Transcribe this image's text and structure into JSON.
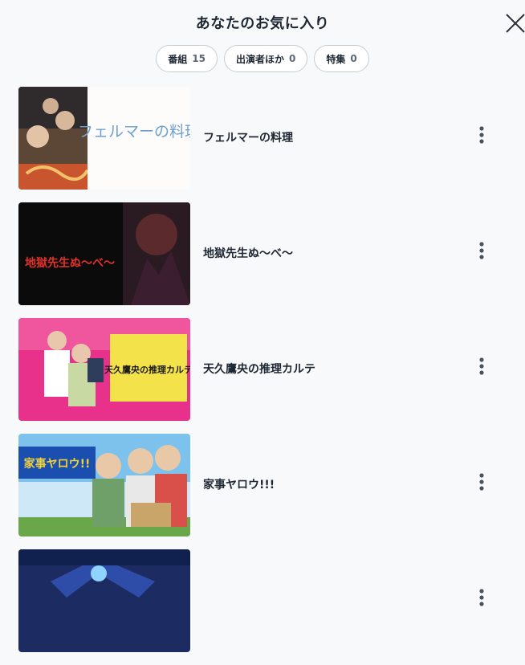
{
  "header": {
    "title": "あなたのお気に入り",
    "close_icon": "close-icon"
  },
  "tabs": [
    {
      "label": "番組",
      "count": "15"
    },
    {
      "label": "出演者ほか",
      "count": "0"
    },
    {
      "label": "特集",
      "count": "0"
    }
  ],
  "items": [
    {
      "title": "フェルマーの料理",
      "thumb_text": "フェルマーの料理"
    },
    {
      "title": "地獄先生ぬ～べ～",
      "thumb_text": "地獄先生ぬ～べ～"
    },
    {
      "title": "天久鷹央の推理カルテ",
      "thumb_text": "天久鷹央の推理カルテ"
    },
    {
      "title": "家事ヤロウ!!!",
      "thumb_text": "家事ヤロウ!!"
    },
    {
      "title": "",
      "thumb_text": ""
    }
  ],
  "icons": {
    "more": "more-vertical-icon"
  }
}
